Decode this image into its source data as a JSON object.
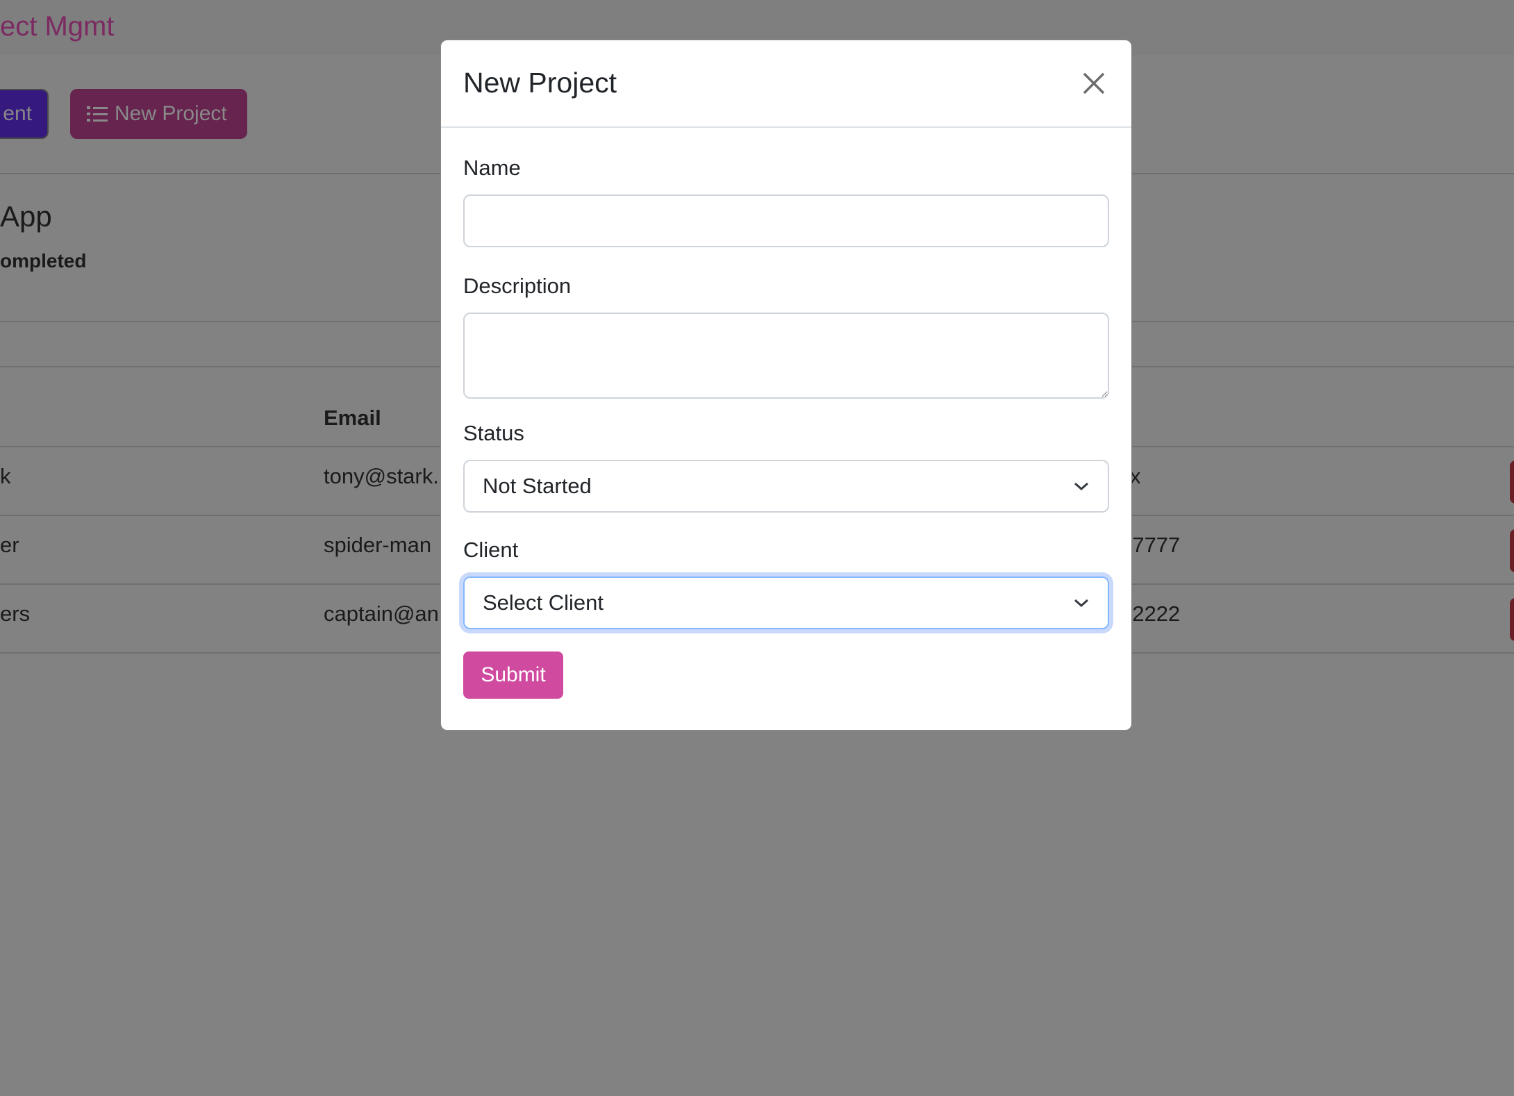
{
  "background": {
    "brand": "ect Mgmt",
    "add_client_label": "ent",
    "new_project_label": "New Project",
    "project_name": "App",
    "project_status": "ompleted",
    "table": {
      "headers": {
        "email": "Email"
      },
      "rows": [
        {
          "name": "k",
          "email": "tony@stark.",
          "phone": "x"
        },
        {
          "name": "er",
          "email": "spider-man",
          "phone": "-7777"
        },
        {
          "name": "ers",
          "email": "captain@an",
          "phone": "-2222"
        }
      ]
    },
    "colors": {
      "overlay": "#828282",
      "brand": "#7c2a62",
      "client_button": "#35197f",
      "project_button": "#66244f",
      "delete_button": "#6b2026"
    }
  },
  "modal": {
    "title": "New Project",
    "close_icon": "close-icon",
    "fields": {
      "name": {
        "label": "Name",
        "value": ""
      },
      "description": {
        "label": "Description",
        "value": ""
      },
      "status": {
        "label": "Status",
        "selected": "Not Started"
      },
      "client": {
        "label": "Client",
        "selected": "Select Client"
      }
    },
    "submit_label": "Submit",
    "colors": {
      "submit": "#d04aa0",
      "focus_ring": "#c9d9fb"
    }
  }
}
